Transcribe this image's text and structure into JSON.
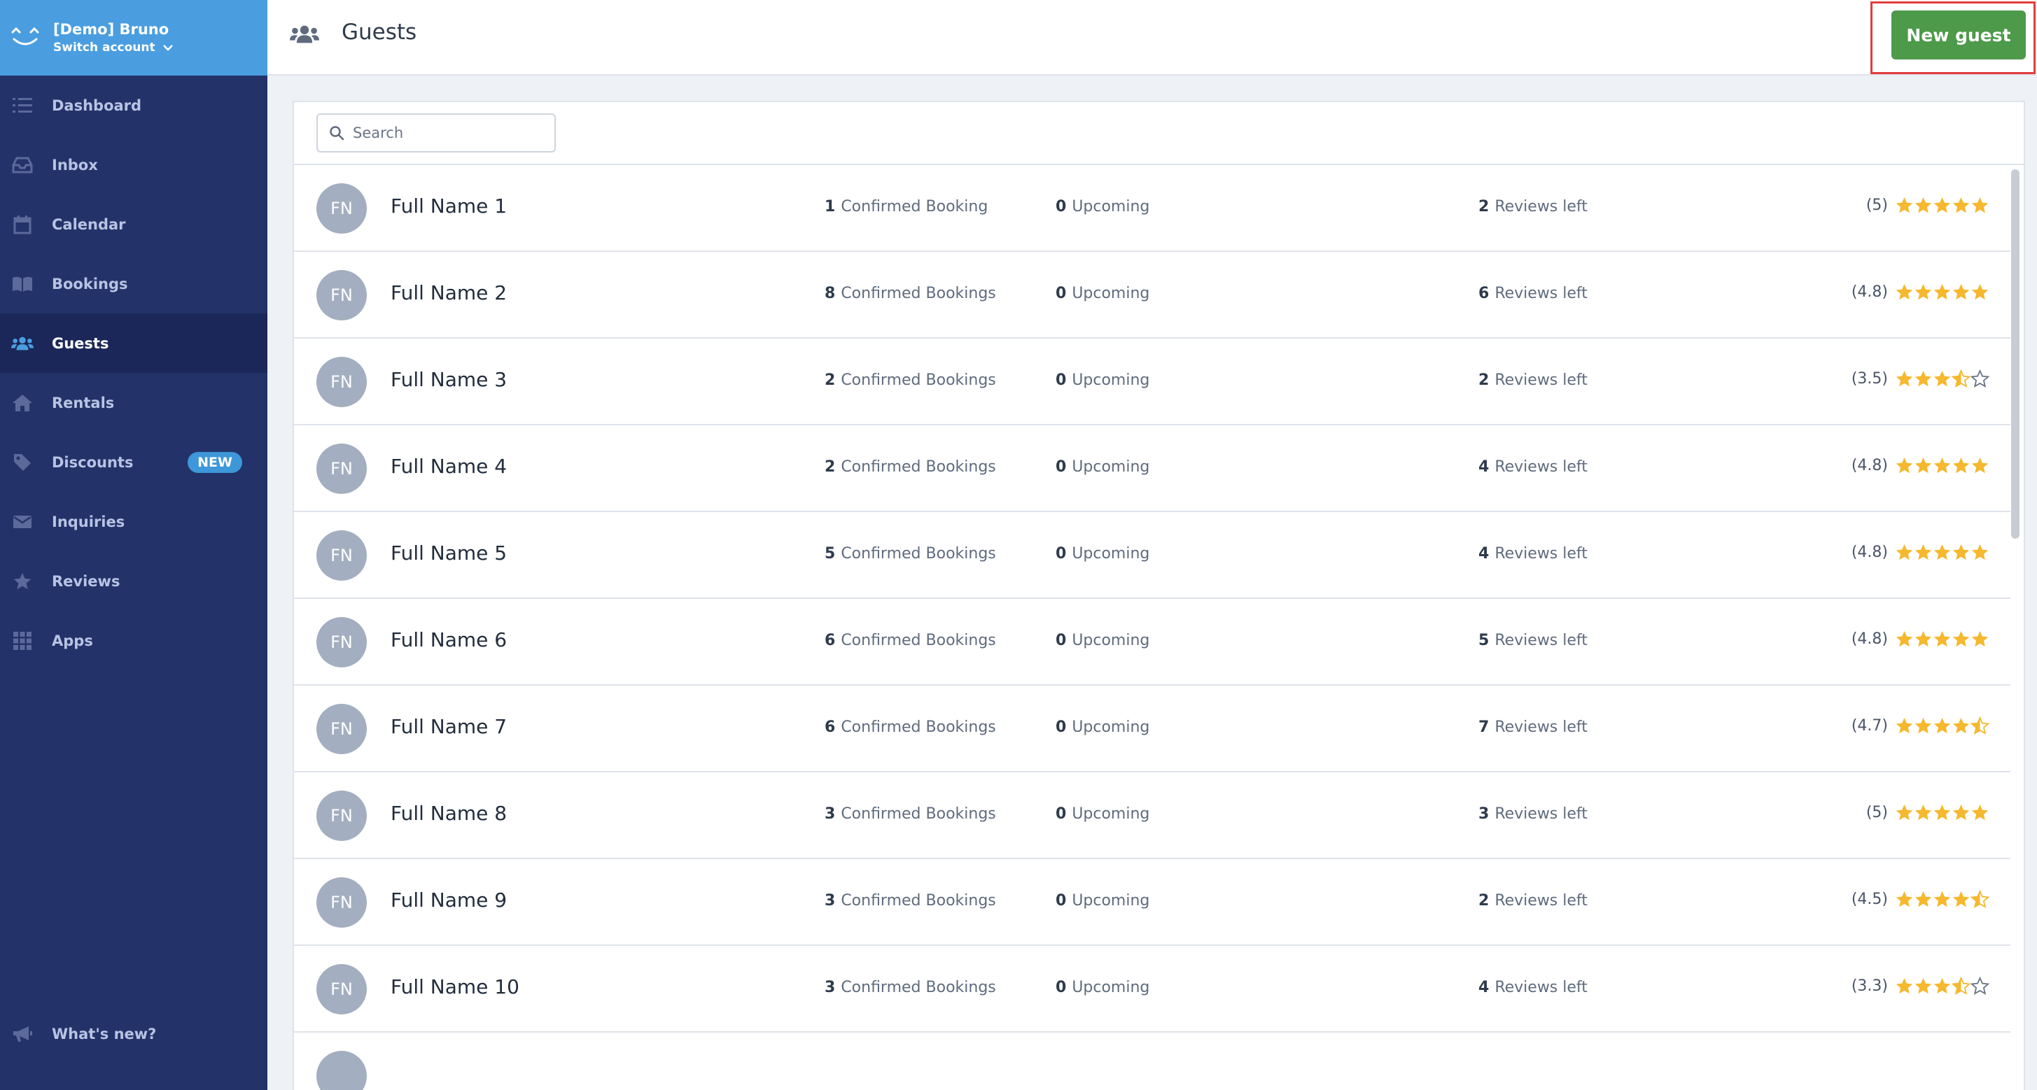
{
  "account": {
    "name": "[Demo] Bruno",
    "switch_label": "Switch account"
  },
  "nav": [
    {
      "key": "dashboard",
      "label": "Dashboard",
      "icon": "list-icon"
    },
    {
      "key": "inbox",
      "label": "Inbox",
      "icon": "inbox-icon"
    },
    {
      "key": "calendar",
      "label": "Calendar",
      "icon": "calendar-icon"
    },
    {
      "key": "bookings",
      "label": "Bookings",
      "icon": "book-icon"
    },
    {
      "key": "guests",
      "label": "Guests",
      "icon": "users-icon",
      "active": true
    },
    {
      "key": "rentals",
      "label": "Rentals",
      "icon": "home-icon"
    },
    {
      "key": "discounts",
      "label": "Discounts",
      "icon": "tag-icon",
      "badge": "NEW"
    },
    {
      "key": "inquiries",
      "label": "Inquiries",
      "icon": "envelope-icon"
    },
    {
      "key": "reviews",
      "label": "Reviews",
      "icon": "star-icon"
    },
    {
      "key": "apps",
      "label": "Apps",
      "icon": "grid-icon"
    }
  ],
  "nav_bottom": [
    {
      "key": "whats-new",
      "label": "What's new?",
      "icon": "megaphone-icon"
    }
  ],
  "header": {
    "title": "Guests",
    "new_button": "New guest"
  },
  "search": {
    "placeholder": "Search",
    "value": ""
  },
  "colors": {
    "sidebar": "#233369",
    "account_bar": "#4a9ee0",
    "primary_button": "#4c9a4a",
    "star": "#f5b82e",
    "badge": "#3d97d8"
  },
  "guests": [
    {
      "initials": "FN",
      "name": "Full Name 1",
      "confirmed_count": "1",
      "confirmed_label": "Confirmed Booking",
      "upcoming_count": "0",
      "upcoming_label": "Upcoming",
      "reviews_count": "2",
      "reviews_label": "Reviews left",
      "rating_text": "(5)",
      "rating": 5
    },
    {
      "initials": "FN",
      "name": "Full Name 2",
      "confirmed_count": "8",
      "confirmed_label": "Confirmed Bookings",
      "upcoming_count": "0",
      "upcoming_label": "Upcoming",
      "reviews_count": "6",
      "reviews_label": "Reviews left",
      "rating_text": "(4.8)",
      "rating": 4.8
    },
    {
      "initials": "FN",
      "name": "Full Name 3",
      "confirmed_count": "2",
      "confirmed_label": "Confirmed Bookings",
      "upcoming_count": "0",
      "upcoming_label": "Upcoming",
      "reviews_count": "2",
      "reviews_label": "Reviews left",
      "rating_text": "(3.5)",
      "rating": 3.5
    },
    {
      "initials": "FN",
      "name": "Full Name 4",
      "confirmed_count": "2",
      "confirmed_label": "Confirmed Bookings",
      "upcoming_count": "0",
      "upcoming_label": "Upcoming",
      "reviews_count": "4",
      "reviews_label": "Reviews left",
      "rating_text": "(4.8)",
      "rating": 4.8
    },
    {
      "initials": "FN",
      "name": "Full Name 5",
      "confirmed_count": "5",
      "confirmed_label": "Confirmed Bookings",
      "upcoming_count": "0",
      "upcoming_label": "Upcoming",
      "reviews_count": "4",
      "reviews_label": "Reviews left",
      "rating_text": "(4.8)",
      "rating": 4.8
    },
    {
      "initials": "FN",
      "name": "Full Name 6",
      "confirmed_count": "6",
      "confirmed_label": "Confirmed Bookings",
      "upcoming_count": "0",
      "upcoming_label": "Upcoming",
      "reviews_count": "5",
      "reviews_label": "Reviews left",
      "rating_text": "(4.8)",
      "rating": 4.8
    },
    {
      "initials": "FN",
      "name": "Full Name 7",
      "confirmed_count": "6",
      "confirmed_label": "Confirmed Bookings",
      "upcoming_count": "0",
      "upcoming_label": "Upcoming",
      "reviews_count": "7",
      "reviews_label": "Reviews left",
      "rating_text": "(4.7)",
      "rating": 4.7
    },
    {
      "initials": "FN",
      "name": "Full Name 8",
      "confirmed_count": "3",
      "confirmed_label": "Confirmed Bookings",
      "upcoming_count": "0",
      "upcoming_label": "Upcoming",
      "reviews_count": "3",
      "reviews_label": "Reviews left",
      "rating_text": "(5)",
      "rating": 5
    },
    {
      "initials": "FN",
      "name": "Full Name 9",
      "confirmed_count": "3",
      "confirmed_label": "Confirmed Bookings",
      "upcoming_count": "0",
      "upcoming_label": "Upcoming",
      "reviews_count": "2",
      "reviews_label": "Reviews left",
      "rating_text": "(4.5)",
      "rating": 4.5
    },
    {
      "initials": "FN",
      "name": "Full Name 10",
      "confirmed_count": "3",
      "confirmed_label": "Confirmed Bookings",
      "upcoming_count": "0",
      "upcoming_label": "Upcoming",
      "reviews_count": "4",
      "reviews_label": "Reviews left",
      "rating_text": "(3.3)",
      "rating": 3.3
    }
  ]
}
